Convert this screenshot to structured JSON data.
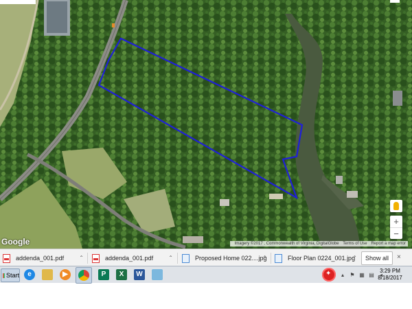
{
  "map": {
    "logo_text": "Google",
    "attribution": [
      "Imagery ©2017 , Commonwealth of Virginia, DigitalGlobe",
      "Terms of Use",
      "Report a map error"
    ],
    "zoom_in": "+",
    "zoom_out": "−",
    "parcel_outline_color": "#1f1fd8"
  },
  "downloads": {
    "items": [
      {
        "name": "addenda_001.pdf",
        "type": "pdf"
      },
      {
        "name": "addenda_001.pdf",
        "type": "pdf"
      },
      {
        "name": "Proposed Home 022....jpg",
        "type": "image"
      },
      {
        "name": "Floor Plan 0224_001.jpg",
        "type": "image"
      }
    ],
    "show_all_label": "Show all",
    "close_label": "×"
  },
  "taskbar": {
    "start_label": "Start",
    "apps": [
      {
        "name": "ie",
        "glyph": "e",
        "color": "#1e88e5"
      },
      {
        "name": "explorer",
        "glyph": "",
        "color": "#e0b84a"
      },
      {
        "name": "media",
        "glyph": "▶",
        "color": "#f08a24"
      },
      {
        "name": "chrome",
        "glyph": "",
        "color": "#2e9e46"
      },
      {
        "name": "publisher",
        "glyph": "P",
        "color": "#0b7a54"
      },
      {
        "name": "excel",
        "glyph": "X",
        "color": "#1d7044"
      },
      {
        "name": "word",
        "glyph": "W",
        "color": "#2b579a"
      },
      {
        "name": "paint",
        "glyph": "",
        "color": "#7cb8de"
      }
    ],
    "time": "3:29 PM",
    "date": "8/18/2017"
  }
}
